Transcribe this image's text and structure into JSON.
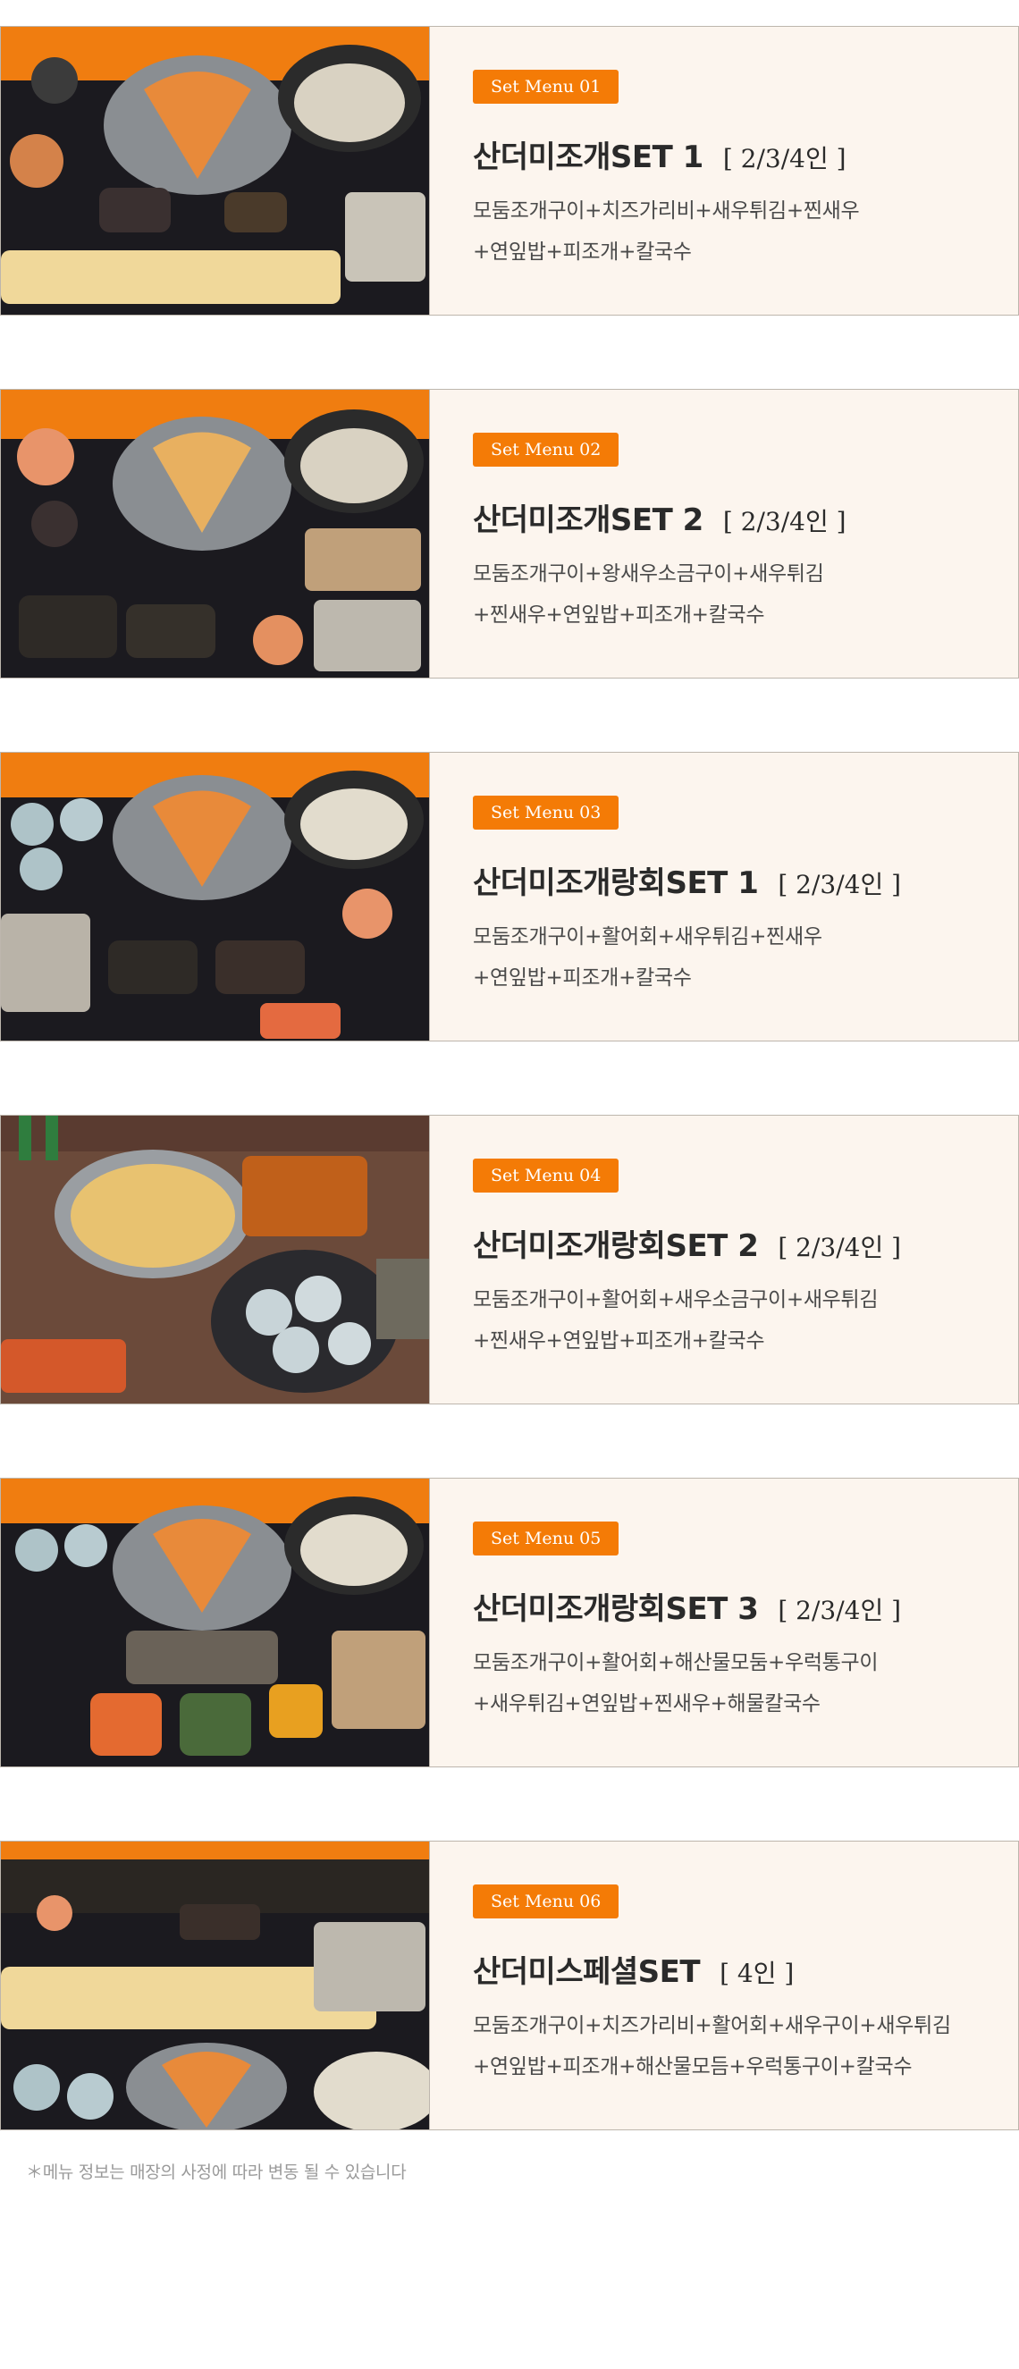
{
  "colors": {
    "badge": "#f47b06",
    "card_background": "#fcf5ee",
    "card_border": "#bdb6ad",
    "title": "#2a2a2a",
    "description": "#4a4a4a",
    "notice": "#9a9a9a"
  },
  "menus": [
    {
      "badge": "Set Menu 01",
      "title": "산더미조개SET 1",
      "people": "[ 2/3/4인 ]",
      "desc_line1": "모둠조개구이+치즈가리비+새우튀김+찐새우",
      "desc_line2": "+연잎밥+피조개+칼국수",
      "photo": "seafood-set-photo"
    },
    {
      "badge": "Set Menu 02",
      "title": "산더미조개SET 2",
      "people": "[ 2/3/4인 ]",
      "desc_line1": "모둠조개구이+왕새우소금구이+새우튀김",
      "desc_line2": "+찐새우+연잎밥+피조개+칼국수",
      "photo": "seafood-set-photo"
    },
    {
      "badge": "Set Menu 03",
      "title": "산더미조개랑회SET 1",
      "people": "[ 2/3/4인 ]",
      "desc_line1": "모둠조개구이+활어회+새우튀김+찐새우",
      "desc_line2": "+연잎밥+피조개+칼국수",
      "photo": "seafood-set-photo"
    },
    {
      "badge": "Set Menu 04",
      "title": "산더미조개랑회SET 2",
      "people": "[ 2/3/4인 ]",
      "desc_line1": "모둠조개구이+활어회+새우소금구이+새우튀김",
      "desc_line2": "+찐새우+연잎밥+피조개+칼국수",
      "photo": "seafood-set-photo"
    },
    {
      "badge": "Set Menu 05",
      "title": "산더미조개랑회SET 3",
      "people": "[ 2/3/4인 ]",
      "desc_line1": "모둠조개구이+활어회+해산물모둠+우럭통구이",
      "desc_line2": "+새우튀김+연잎밥+찐새우+해물칼국수",
      "photo": "seafood-set-photo"
    },
    {
      "badge": "Set Menu 06",
      "title": "산더미스페셜SET",
      "people": "[ 4인 ]",
      "desc_line1": "모둠조개구이+치즈가리비+활어회+새우구이+새우튀김",
      "desc_line2": "+연잎밥+피조개+해산물모듬+우럭통구이+칼국수",
      "photo": "seafood-set-photo"
    }
  ],
  "notice": "＊메뉴 정보는 매장의 사정에 따라 변동 될 수 있습니다"
}
